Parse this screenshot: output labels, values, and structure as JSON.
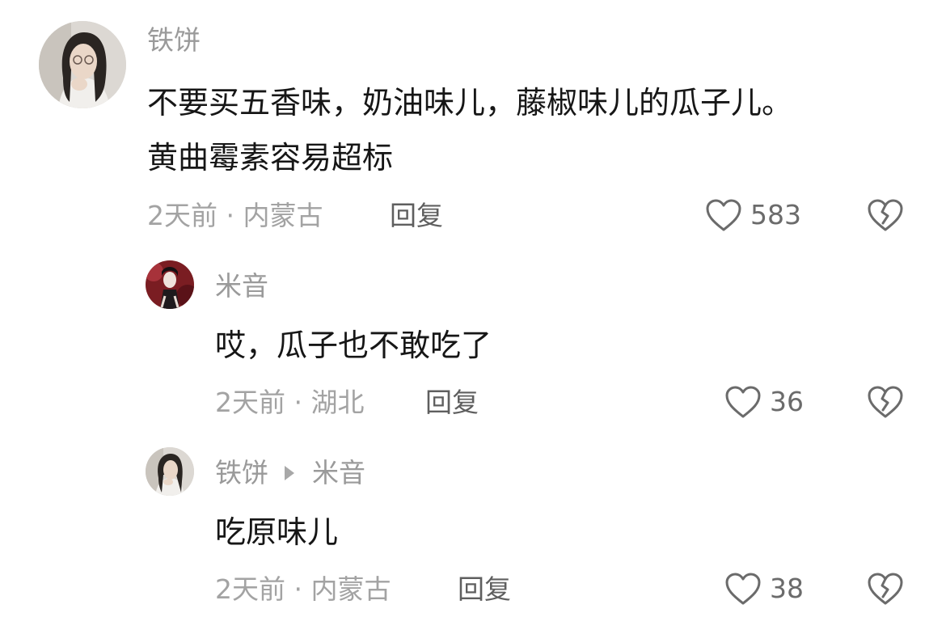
{
  "comments": [
    {
      "username": "铁饼",
      "text_line1": "不要买五香味，奶油味儿，藤椒味儿的瓜子儿。",
      "text_line2": "黄曲霉素容易超标",
      "time": "2天前",
      "location": "内蒙古",
      "reply_label": "回复",
      "likes": "583"
    },
    {
      "username": "米音",
      "text": "哎，瓜子也不敢吃了",
      "time": "2天前",
      "location": "湖北",
      "reply_label": "回复",
      "likes": "36"
    },
    {
      "username": "铁饼",
      "reply_to": "米音",
      "text": "吃原味儿",
      "time": "2天前",
      "location": "内蒙古",
      "reply_label": "回复",
      "likes": "38"
    }
  ],
  "colors": {
    "text": "#161616",
    "muted": "#9a9a9a",
    "icon": "#6b6b6b"
  }
}
